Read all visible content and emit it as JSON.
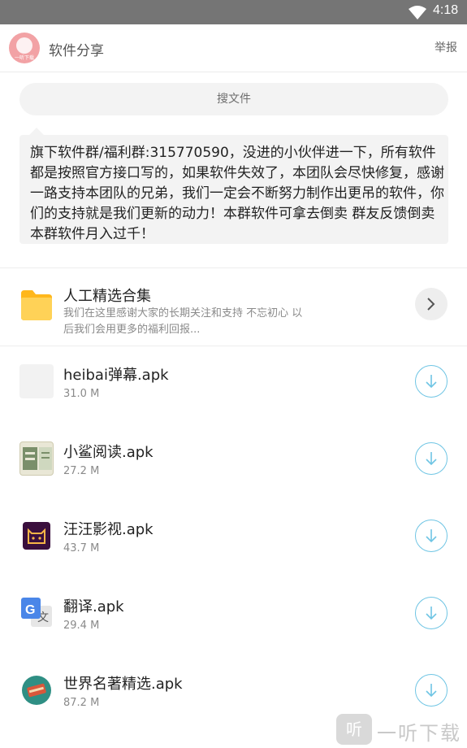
{
  "status_bar": {
    "time": "4:18"
  },
  "header": {
    "title": "软件分享",
    "report_label": "举报",
    "avatar_text": "一听下载"
  },
  "search": {
    "placeholder": "搜文件"
  },
  "notice": {
    "text": "旗下软件群/福利群:315770590，没进的小伙伴进一下，所有软件都是按照官方接口写的，如果软件失效了，本团队会尽快修复，感谢一路支持本团队的兄弟，我们一定会不断努力制作出更吊的软件，你们的支持就是我们更新的动力！本群软件可拿去倒卖 群友反馈倒卖本群软件月入过千！"
  },
  "collection": {
    "name": "人工精选合集",
    "description": "我们在这里感谢大家的长期关注和支持 不忘初心 以后我们会用更多的福利回报...",
    "icon": "folder-icon"
  },
  "files": [
    {
      "name": "heibai弹幕.apk",
      "size": "31.0 M",
      "icon": "blank-app-icon"
    },
    {
      "name": "小鲨阅读.apk",
      "size": "27.2 M",
      "icon": "book-reader-icon"
    },
    {
      "name": "汪汪影视.apk",
      "size": "43.7 M",
      "icon": "cat-face-icon"
    },
    {
      "name": "翻译.apk",
      "size": "29.4 M",
      "icon": "google-translate-icon"
    },
    {
      "name": "世界名著精选.apk",
      "size": "87.2 M",
      "icon": "classic-books-icon"
    }
  ],
  "watermark": {
    "text": "一听下载",
    "logo_text": "听"
  },
  "colors": {
    "accent": "#6fc5e4",
    "status_bar": "#757575",
    "folder": "#ffc83d"
  }
}
